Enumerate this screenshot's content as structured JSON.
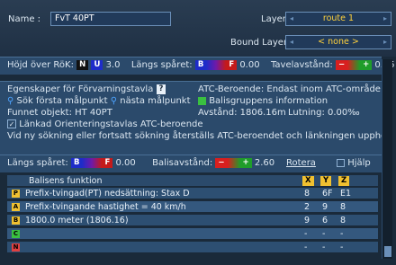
{
  "header": {
    "name_label": "Name :",
    "name_value": "FvT 40PT",
    "layer_label": "Layer:",
    "layer_value": "route 1",
    "bound_layer_label": "Bound Layer:",
    "bound_layer_value": "< none >"
  },
  "top_row": {
    "hojd_label": "Höjd över RöK:",
    "n": "N",
    "u": "U",
    "u_val": "3.0",
    "langs_label": "Längs spåret:",
    "b": "B",
    "f": "F",
    "langs_val": "0.00",
    "tavel_label": "Tavelavstånd:",
    "minus": "−",
    "plus": "+",
    "tavel_val": "0.05"
  },
  "props": {
    "egenskaper": "Egenskaper för Förvarningstavla",
    "help_q": "?",
    "atc_label": "ATC-Beroende:",
    "atc_value": "Endast inom ATC-område",
    "sok_forsta": "Sök första målpunkt",
    "nasta": "nästa målpunkt",
    "balis_info": "Balisgruppens information",
    "funnet": "Funnet objekt: HT 40PT",
    "avstand": "Avstånd: 1806.16m",
    "lutning": "Lutning: 0.00‰",
    "lankad_check": "✓",
    "lankad": "Länkad Orienteringstavlas ATC-beroende",
    "vid_ny": "Vid ny sökning eller fortsatt sökning återställs ATC-beroendet och länkningen upphör"
  },
  "second_row": {
    "langs_label": "Längs spåret:",
    "b": "B",
    "f": "F",
    "langs_val": "0.00",
    "balis_label": "Balisavstånd:",
    "minus": "−",
    "plus": "+",
    "balis_val": "2.60",
    "rotera": "Rotera",
    "hjalp": "Hjälp"
  },
  "table": {
    "header": "Balisens funktion",
    "col_headers": [
      "X",
      "Y",
      "Z"
    ],
    "rows": [
      {
        "sym": "P",
        "color": "#f0c030",
        "text": "Prefix-tvingad(PT) nedsättning: Stax D",
        "x": "8",
        "y": "6F",
        "z": "E1"
      },
      {
        "sym": "A",
        "color": "#f0c030",
        "text": "Prefix-tvingande hastighet = 40 km/h",
        "x": "2",
        "y": "9",
        "z": "8"
      },
      {
        "sym": "B",
        "color": "#f0c030",
        "text": "1800.0 meter (1806.16)",
        "x": "9",
        "y": "6",
        "z": "8"
      },
      {
        "sym": "C",
        "color": "#3ac040",
        "text": "",
        "x": "-",
        "y": "-",
        "z": "-"
      },
      {
        "sym": "N",
        "color": "#e04040",
        "text": "",
        "x": "-",
        "y": "-",
        "z": "-"
      }
    ]
  }
}
